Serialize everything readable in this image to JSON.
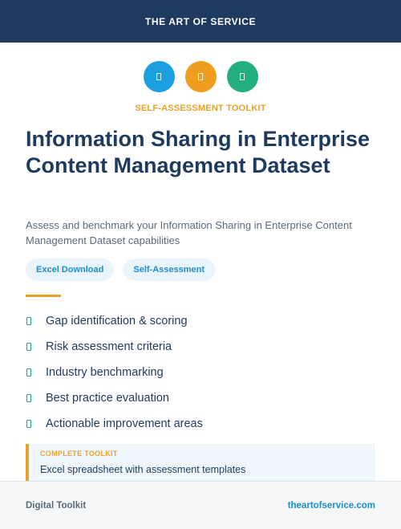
{
  "header": {
    "title": "THE ART OF SERVICE"
  },
  "icons": [
    {
      "name": "clipboard-icon",
      "color": "#1a9fe0"
    },
    {
      "name": "document-icon",
      "color": "#ef9d1e"
    },
    {
      "name": "checklist-icon",
      "color": "#21b07d"
    }
  ],
  "kicker": "SELF-ASSESSMENT TOOLKIT",
  "title": "Information Sharing in Enterprise Content Management Dataset",
  "subtitle": "Assess and benchmark your Information Sharing in Enterprise Content Management Dataset capabilities",
  "tags": [
    "Excel Download",
    "Self-Assessment"
  ],
  "features": [
    "Gap identification & scoring",
    "Risk assessment criteria",
    "Industry benchmarking",
    "Best practice evaluation",
    "Actionable improvement areas"
  ],
  "callout": {
    "label": "COMPLETE TOOLKIT",
    "text": "Excel spreadsheet with assessment templates"
  },
  "footer": {
    "left": "Digital Toolkit",
    "right": "theartofservice.com"
  },
  "colors": {
    "navy": "#1f3a5f",
    "accent": "#e8a22a",
    "blue": "#1a8fd0",
    "green": "#21b07d"
  }
}
